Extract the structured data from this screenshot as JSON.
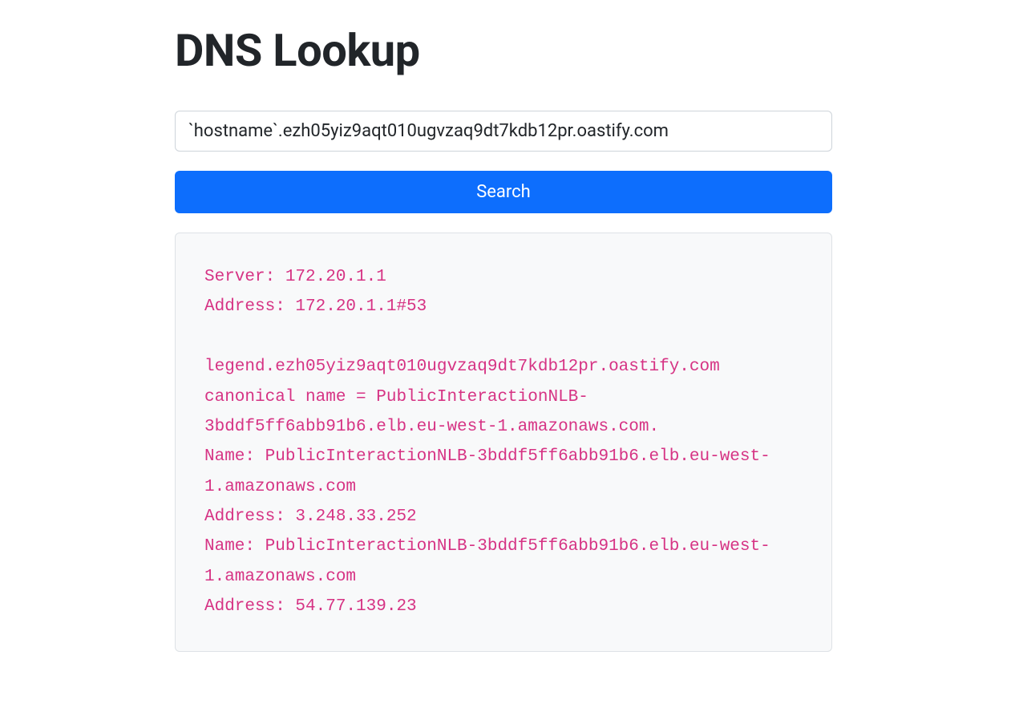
{
  "page": {
    "title": "DNS Lookup"
  },
  "form": {
    "input_value": "`hostname`.ezh05yiz9aqt010ugvzaq9dt7kdb12pr.oastify.com",
    "button_label": "Search"
  },
  "output": {
    "text": "Server: 172.20.1.1\nAddress: 172.20.1.1#53\n\nlegend.ezh05yiz9aqt010ugvzaq9dt7kdb12pr.oastify.com canonical name = PublicInteractionNLB-3bddf5ff6abb91b6.elb.eu-west-1.amazonaws.com.\nName: PublicInteractionNLB-3bddf5ff6abb91b6.elb.eu-west-1.amazonaws.com\nAddress: 3.248.33.252\nName: PublicInteractionNLB-3bddf5ff6abb91b6.elb.eu-west-1.amazonaws.com\nAddress: 54.77.139.23\n"
  }
}
